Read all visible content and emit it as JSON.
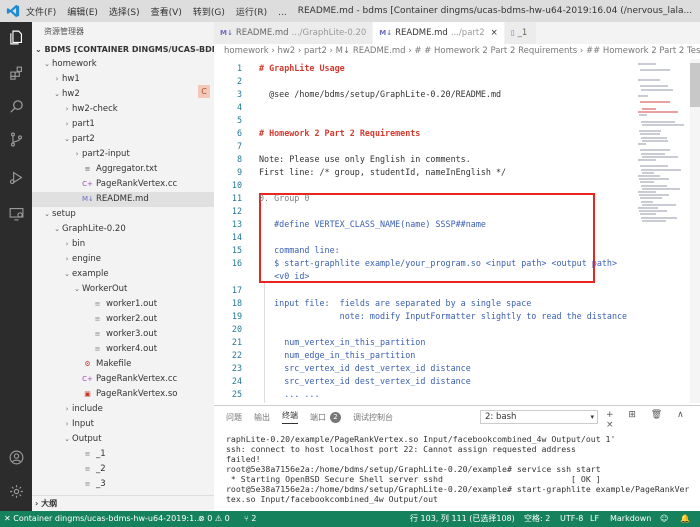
{
  "titlebar": {
    "menu": [
      "文件(F)",
      "编辑(E)",
      "选择(S)",
      "查看(V)",
      "转到(G)",
      "运行(R)",
      "..."
    ],
    "title": "README.md - bdms [Container dingms/ucas-bdms-hw-u64-2019:16.04 (/nervous_lala..."
  },
  "sidebar": {
    "header": "资源管理器",
    "section": "BDMS [CONTAINER DINGMS/UCAS-BDMS-H...",
    "badge": "C",
    "outline": "大纲",
    "tree": [
      {
        "label": "homework",
        "depth": 0,
        "type": "folder",
        "open": true
      },
      {
        "label": "hw1",
        "depth": 1,
        "type": "folder",
        "open": false
      },
      {
        "label": "hw2",
        "depth": 1,
        "type": "folder",
        "open": true
      },
      {
        "label": "hw2-check",
        "depth": 2,
        "type": "folder",
        "open": false
      },
      {
        "label": "part1",
        "depth": 2,
        "type": "folder",
        "open": false
      },
      {
        "label": "part2",
        "depth": 2,
        "type": "folder",
        "open": true
      },
      {
        "label": "part2-input",
        "depth": 3,
        "type": "folder",
        "open": false
      },
      {
        "label": "Aggregator.txt",
        "depth": 3,
        "type": "txt"
      },
      {
        "label": "PageRankVertex.cc",
        "depth": 3,
        "type": "cpp"
      },
      {
        "label": "README.md",
        "depth": 3,
        "type": "md",
        "selected": true
      },
      {
        "label": "setup",
        "depth": 0,
        "type": "folder",
        "open": true
      },
      {
        "label": "GraphLite-0.20",
        "depth": 1,
        "type": "folder",
        "open": true
      },
      {
        "label": "bin",
        "depth": 2,
        "type": "folder",
        "open": false
      },
      {
        "label": "engine",
        "depth": 2,
        "type": "folder",
        "open": false
      },
      {
        "label": "example",
        "depth": 2,
        "type": "folder",
        "open": true
      },
      {
        "label": "WorkerOut",
        "depth": 3,
        "type": "folder",
        "open": true
      },
      {
        "label": "worker1.out",
        "depth": 4,
        "type": "file"
      },
      {
        "label": "worker2.out",
        "depth": 4,
        "type": "file"
      },
      {
        "label": "worker3.out",
        "depth": 4,
        "type": "file"
      },
      {
        "label": "worker4.out",
        "depth": 4,
        "type": "file"
      },
      {
        "label": "Makefile",
        "depth": 3,
        "type": "make"
      },
      {
        "label": "PageRankVertex.cc",
        "depth": 3,
        "type": "cpp"
      },
      {
        "label": "PageRankVertex.so",
        "depth": 3,
        "type": "so"
      },
      {
        "label": "include",
        "depth": 2,
        "type": "folder",
        "open": false
      },
      {
        "label": "Input",
        "depth": 2,
        "type": "folder",
        "open": false
      },
      {
        "label": "Output",
        "depth": 2,
        "type": "folder",
        "open": true
      },
      {
        "label": "_1",
        "depth": 3,
        "type": "file"
      },
      {
        "label": "_2",
        "depth": 3,
        "type": "file"
      },
      {
        "label": "_3",
        "depth": 3,
        "type": "file"
      }
    ]
  },
  "tabs": [
    {
      "icon": "M↓",
      "label": "README.md",
      "sub": ".../GraphLite-0.20"
    },
    {
      "icon": "M↓",
      "label": "README.md",
      "sub": ".../part2",
      "active": true,
      "close": "×"
    },
    {
      "icon": "▯",
      "label": "_1",
      "sub": ""
    }
  ],
  "breadcrumb": "homework › hw2 › part2 › M↓ README.md › # # Homework 2 Part 2 Requirements › ## Homework 2 Part 2 Test Cc",
  "editor": {
    "lines": [
      {
        "n": "1",
        "text": "# GraphLite Usage",
        "style": "h"
      },
      {
        "n": "2",
        "text": "",
        "style": ""
      },
      {
        "n": "3",
        "text": "  @see /home/bdms/setup/GraphLite-0.20/README.md",
        "style": ""
      },
      {
        "n": "4",
        "text": "",
        "style": ""
      },
      {
        "n": "5",
        "text": "",
        "style": ""
      },
      {
        "n": "6",
        "text": "# Homework 2 Part 2 Requirements",
        "style": "h"
      },
      {
        "n": "7",
        "text": "",
        "style": ""
      },
      {
        "n": "8",
        "text": "Note: Please use only English in comments.",
        "style": ""
      },
      {
        "n": "9",
        "text": "First line: /* group, studentId, nameInEnglish */",
        "style": ""
      },
      {
        "n": "10",
        "text": "",
        "style": ""
      },
      {
        "n": "11",
        "text": "0. Group 0",
        "style": "dim"
      },
      {
        "n": "12",
        "text": "",
        "style": ""
      },
      {
        "n": "13",
        "text": "   #define VERTEX_CLASS_NAME(name) SSSP##name",
        "style": "blue"
      },
      {
        "n": "14",
        "text": "",
        "style": ""
      },
      {
        "n": "15",
        "text": "   command line:",
        "style": "blue"
      },
      {
        "n": "16",
        "text": "   $ start-graphlite example/your_program.so <input path> <output path>",
        "style": "blue"
      },
      {
        "n": "",
        "text": "   <v0 id>",
        "style": "blue"
      },
      {
        "n": "17",
        "text": "",
        "style": ""
      },
      {
        "n": "18",
        "text": "   input file:  fields are separated by a single space",
        "style": "blue"
      },
      {
        "n": "19",
        "text": "                note: modify InputFormatter slightly to read the distance",
        "style": "blue"
      },
      {
        "n": "20",
        "text": "",
        "style": ""
      },
      {
        "n": "21",
        "text": "     num_vertex_in_this_partition",
        "style": "blue"
      },
      {
        "n": "22",
        "text": "     num_edge_in_this_partition",
        "style": "blue"
      },
      {
        "n": "23",
        "text": "     src_vertex_id dest_vertex_id distance",
        "style": "blue"
      },
      {
        "n": "24",
        "text": "     src_vertex_id dest_vertex_id distance",
        "style": "blue"
      },
      {
        "n": "25",
        "text": "     ... ...",
        "style": "blue"
      }
    ]
  },
  "panel": {
    "tabs": [
      "问题",
      "输出",
      "终端",
      "端口",
      "调试控制台"
    ],
    "active_tab": "终端",
    "ports_count": "2",
    "terminal_select": "2: bash",
    "icons": "+ ⊞ 🗑 ∧ ×",
    "terminal_lines": [
      "raphLite-0.20/example/PageRankVertex.so Input/facebookcombined_4w Output/out 1'",
      "ssh: connect to host localhost port 22: Cannot assign requested address",
      "failed!",
      "root@5e38a7156e2a:/home/bdms/setup/GraphLite-0.20/example# service ssh start",
      " * Starting OpenBSD Secure Shell server sshd                          [ OK ]",
      "root@5e38a7156e2a:/home/bdms/setup/GraphLite-0.20/example# start-graphlite example/PageRankVer",
      "tex.so Input/facebookcombined_4w Output/out"
    ]
  },
  "statusbar": {
    "remote": "✕ Container dingms/ucas-bdms-hw-u64-2019:1...",
    "problems": "⊗ 0 ⚠ 0",
    "ports": "⑂ 2",
    "position": "行 103, 列 111 (已选择108)",
    "spaces": "空格: 2",
    "encoding": "UTF-8",
    "eol": "LF",
    "language": "Markdown"
  }
}
